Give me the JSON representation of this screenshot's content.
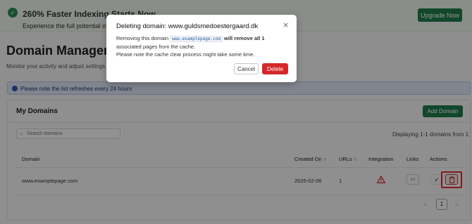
{
  "promo": {
    "title": "260% Faster Indexing Starts Now",
    "subtitle": "Experience the full potential of Prerender",
    "upgrade_label": "Upgrade Now"
  },
  "page": {
    "title": "Domain Manager",
    "subtitle": "Monitor your activity and adjust settings for"
  },
  "notice": {
    "text": "Please note the list refreshes every 24 hours"
  },
  "card": {
    "title": "My Domains",
    "add_label": "Add Domain",
    "search_placeholder": "Search domains",
    "display_text": "Displaying 1-1 domains from 1"
  },
  "table": {
    "columns": [
      "Domain",
      "Created On",
      "URLs",
      "Integration",
      "Links",
      "Actions"
    ],
    "rows": [
      {
        "domain": "www.examplepage.com",
        "created_on": "2025-02-06",
        "urls": "1"
      }
    ]
  },
  "pagination": {
    "current": "1",
    "prev": "<",
    "next": ">"
  },
  "modal": {
    "title": "Deleting domain: www.guldsmedoestergaard.dk",
    "close": "×",
    "line1_pre": "Removing this domain",
    "line1_code": "www.examplepage.com",
    "line1_bold": "will remove all 1",
    "line1_post": "associated pages from the cache.",
    "line2": "Please note the cache clear process might take some time.",
    "cancel_label": "Cancel",
    "delete_label": "Delete"
  },
  "colors": {
    "primary_green": "#1f7a4a",
    "danger_red": "#d62829",
    "highlight_red": "#e12b33",
    "notice_blue": "#2f55b8"
  }
}
